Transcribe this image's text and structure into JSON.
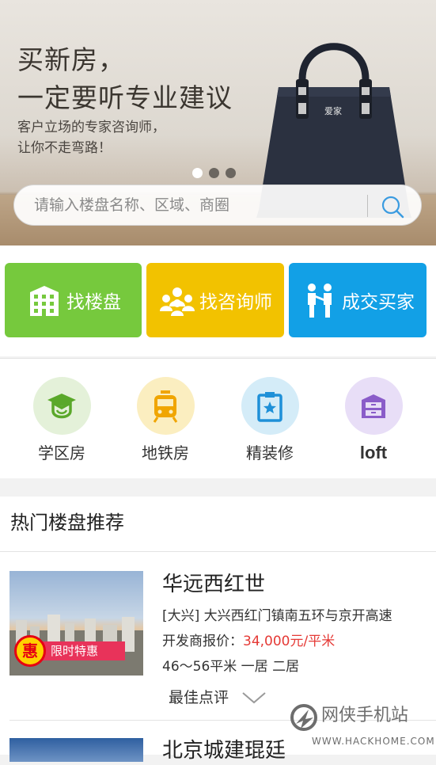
{
  "banner": {
    "headline_line1": "买新房，",
    "headline_line2": "一定要听专业建议",
    "sub_line1": "客户立场的专家咨询师，",
    "sub_line2": "让你不走弯路！",
    "bag_logo": "爱家",
    "slide_count": 3,
    "active_slide": 1
  },
  "search": {
    "placeholder": "请输入楼盘名称、区域、商圈",
    "icon": "search-icon"
  },
  "tiles": [
    {
      "label": "找楼盘",
      "icon": "building-icon",
      "color": "#76c93d"
    },
    {
      "label": "找咨询师",
      "icon": "people-group-icon",
      "color": "#f2c200"
    },
    {
      "label": "成交买家",
      "icon": "handshake-icon",
      "color": "#12a0e6"
    }
  ],
  "features": [
    {
      "label": "学区房",
      "icon": "graduation-cap-icon",
      "bg": "#e4f1d9",
      "fg": "#5aa82a"
    },
    {
      "label": "地铁房",
      "icon": "subway-icon",
      "bg": "#fbeec0",
      "fg": "#f0a500"
    },
    {
      "label": "精装修",
      "icon": "clipboard-star-icon",
      "bg": "#d4ecf8",
      "fg": "#1e90d8"
    },
    {
      "label": "loft",
      "icon": "cabinet-icon",
      "bg": "#e8def7",
      "fg": "#8a5cc9"
    }
  ],
  "hot": {
    "title": "热门楼盘推荐",
    "listings": [
      {
        "name": "华远西红世",
        "location": "[大兴] 大兴西红门镇南五环与京开高速",
        "price_label": "开发商报价：",
        "price_value": "34,000元/平米",
        "size": "46～56平米  一居 二居",
        "review_label": "最佳点评",
        "promo_badge": "惠",
        "promo_text": "限时特惠"
      },
      {
        "name": "北京城建琨廷"
      }
    ]
  },
  "watermark": {
    "name": "网侠手机站",
    "url": "WWW.HACKHOME.COM"
  },
  "colors": {
    "price": "#e53935",
    "tile_green": "#76c93d",
    "tile_yellow": "#f2c200",
    "tile_blue": "#12a0e6"
  }
}
